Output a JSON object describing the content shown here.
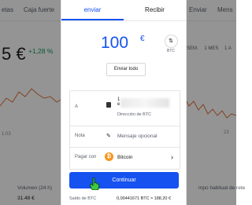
{
  "background": {
    "nav": [
      "etas",
      "Caja fuerte",
      "Enviar",
      "Mens"
    ],
    "price_main": "5 €",
    "change_pct": "+1,28 %",
    "periods": [
      "1 SEM.",
      "1 MES",
      "1 A"
    ],
    "axis_left": "1:03",
    "axis_right": "23",
    "volume_label": "Volumen (24 h)",
    "volume_value": "31.48 €",
    "usual_label": "mpo habitual de rete"
  },
  "modal": {
    "tabs": {
      "send": "enviar",
      "receive": "Recibir"
    },
    "amount": "100",
    "currency_symbol": "€",
    "switch_label": "BTC",
    "send_all": "Enviar todo",
    "form": {
      "to_label": "A",
      "address_prefix": "1",
      "address_prefix2": "e",
      "address_caption": "Dirección de BTC",
      "note_label": "Nota",
      "note_placeholder": "Mensaje opcional",
      "pay_with_label": "Pagar con",
      "pay_with_value": "Bitcoin",
      "btc_symbol": "₿"
    },
    "continue": "Continuar",
    "balance_label": "Saldo de BTC",
    "balance_value": "0,00441671 BTC ≈ 188,20 €"
  },
  "colors": {
    "brand_blue": "#1652f0",
    "btc_orange": "#f7931a",
    "up_green": "#0a9b5a"
  },
  "icons": [
    "switch-currency-icon",
    "wallet-icon",
    "pencil-icon",
    "bitcoin-icon",
    "chevron-right-icon",
    "hand-cursor-icon"
  ]
}
